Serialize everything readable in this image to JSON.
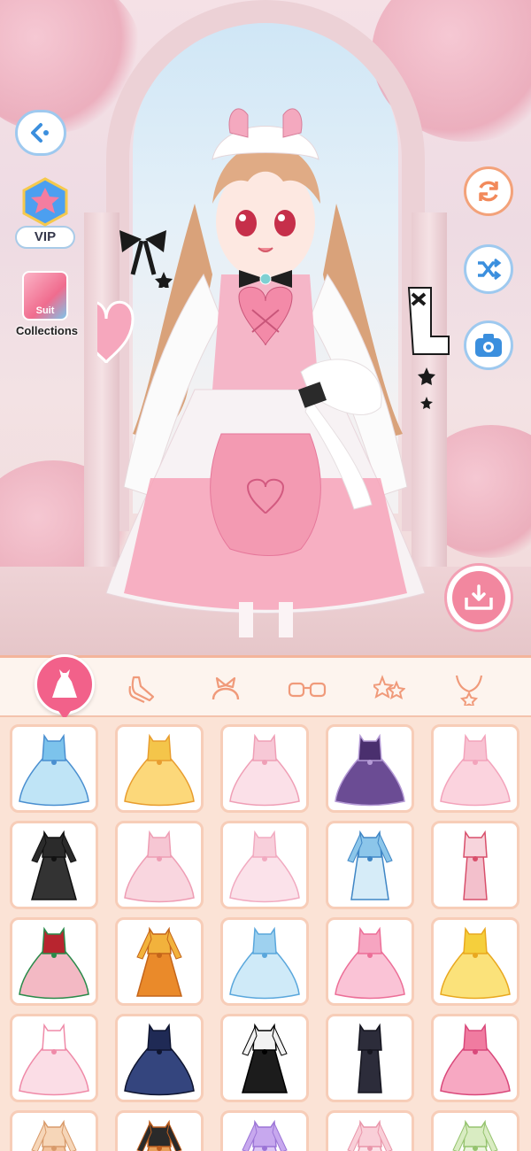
{
  "left_panel": {
    "vip_label": "VIP",
    "suit_card_label": "Suit",
    "collections_label": "Collections"
  },
  "categories": [
    {
      "name": "dress",
      "active": true
    },
    {
      "name": "shoes",
      "active": false
    },
    {
      "name": "headwear",
      "active": false
    },
    {
      "name": "glasses",
      "active": false
    },
    {
      "name": "earrings",
      "active": false
    },
    {
      "name": "necklace",
      "active": false
    }
  ],
  "colors": {
    "accent_pink": "#f2618a",
    "tab_border": "#f4b49b",
    "button_blue": "#9ec9ef",
    "button_orange": "#f3a27a"
  },
  "outfits": [
    {
      "style": "ballgown",
      "top": "#7cc3ec",
      "skirt": "#bfe4f6",
      "trim": "#4a8fd0"
    },
    {
      "style": "ballgown",
      "top": "#f4c54a",
      "skirt": "#fcd87a",
      "trim": "#e89d2f"
    },
    {
      "style": "ballgown",
      "top": "#f7c8d6",
      "skirt": "#fbe0e8",
      "trim": "#ef9fb6"
    },
    {
      "style": "ballgown",
      "top": "#4a2f6e",
      "skirt": "#6b4c94",
      "trim": "#b59bd6"
    },
    {
      "style": "ballgown",
      "top": "#f8c2d2",
      "skirt": "#fbd3de",
      "trim": "#f3a3bb"
    },
    {
      "style": "aline",
      "top": "#2b2b2b",
      "skirt": "#333333",
      "trim": "#111111"
    },
    {
      "style": "ballgown",
      "top": "#f6c6d3",
      "skirt": "#f9d6df",
      "trim": "#ee9db4"
    },
    {
      "style": "ballgown",
      "top": "#f8cfdb",
      "skirt": "#fbe2ea",
      "trim": "#f1aac0"
    },
    {
      "style": "robe",
      "top": "#8cc6ea",
      "skirt": "#d6ecf8",
      "trim": "#3f86c5"
    },
    {
      "style": "slim",
      "top": "#f7d4dc",
      "skirt": "#f3c0cc",
      "trim": "#d84f6b"
    },
    {
      "style": "ballgown",
      "top": "#b8252f",
      "skirt": "#f3b9c4",
      "trim": "#2a8a4a"
    },
    {
      "style": "aline",
      "top": "#f2b23c",
      "skirt": "#ea8a2a",
      "trim": "#c4651a"
    },
    {
      "style": "ballgown",
      "top": "#9ed1ef",
      "skirt": "#cfeaf8",
      "trim": "#5aa7dc"
    },
    {
      "style": "ballgown",
      "top": "#f6a5c1",
      "skirt": "#fac3d6",
      "trim": "#ec6f98"
    },
    {
      "style": "ballgown",
      "top": "#f5cf3c",
      "skirt": "#fbe27a",
      "trim": "#e9a81f"
    },
    {
      "style": "ballgown",
      "top": "#ffffff",
      "skirt": "#fbdde6",
      "trim": "#ef8aa8"
    },
    {
      "style": "ballgown",
      "top": "#1f2a55",
      "skirt": "#34457e",
      "trim": "#0f1530"
    },
    {
      "style": "aline",
      "top": "#f2f2f2",
      "skirt": "#1c1c1c",
      "trim": "#000000"
    },
    {
      "style": "slim",
      "top": "#2c2c3a",
      "skirt": "#2c2c3a",
      "trim": "#15151f"
    },
    {
      "style": "ballgown",
      "top": "#f07ba0",
      "skirt": "#f7a8c2",
      "trim": "#d9487a"
    },
    {
      "style": "aline",
      "top": "#f6d6b8",
      "skirt": "#f3c39c",
      "trim": "#d89a6a"
    },
    {
      "style": "aline",
      "top": "#2a2a2a",
      "skirt": "#e8a05a",
      "trim": "#c06020"
    },
    {
      "style": "aline",
      "top": "#c7a8ee",
      "skirt": "#dcc6f5",
      "trim": "#9b74d6"
    },
    {
      "style": "aline",
      "top": "#f9cfd8",
      "skirt": "#fbe1e7",
      "trim": "#e996aa"
    },
    {
      "style": "aline",
      "top": "#d9ecc2",
      "skirt": "#eaf5dc",
      "trim": "#95c36e"
    }
  ]
}
